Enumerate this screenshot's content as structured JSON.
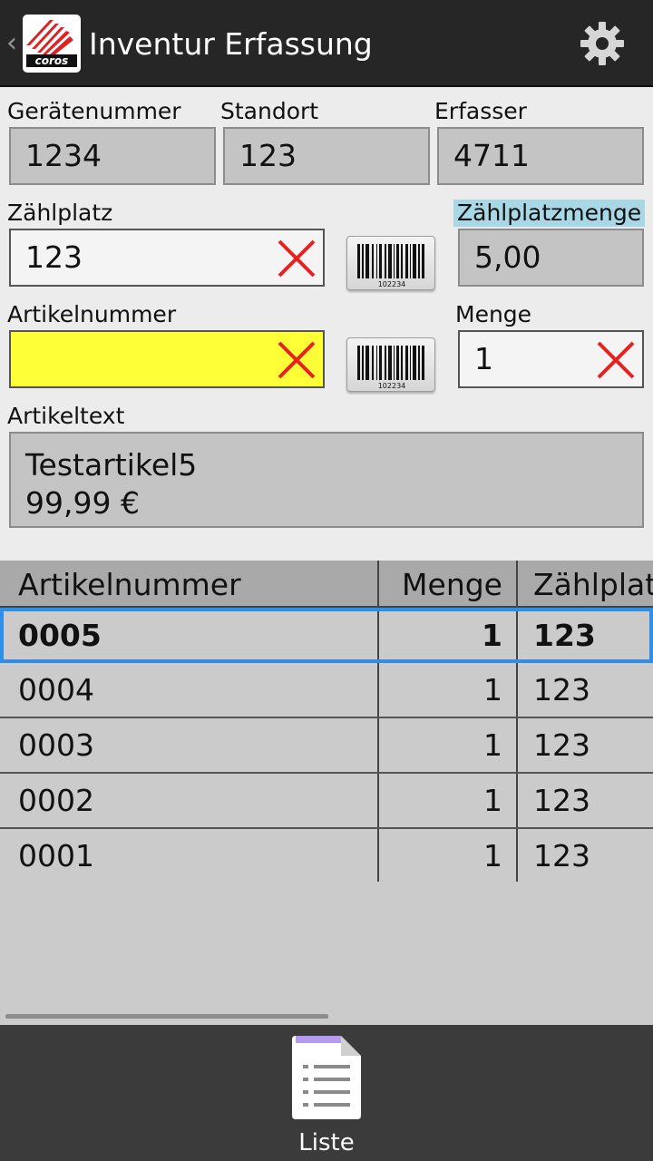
{
  "appbar": {
    "title": "Inventur Erfassung",
    "logo_text": "coros"
  },
  "form": {
    "geraetenummer": {
      "label": "Gerätenummer",
      "value": "1234"
    },
    "standort": {
      "label": "Standort",
      "value": "123"
    },
    "erfasser": {
      "label": "Erfasser",
      "value": "4711"
    },
    "zaehlplatz": {
      "label": "Zählplatz",
      "value": "123"
    },
    "zaehlplatzmenge": {
      "label": "Zählplatzmenge",
      "value": "5,00"
    },
    "artikelnummer": {
      "label": "Artikelnummer",
      "value": ""
    },
    "menge": {
      "label": "Menge",
      "value": "1"
    },
    "artikeltext": {
      "label": "Artikeltext",
      "line1": "Testartikel5",
      "line2": "99,99 €"
    },
    "barcode_number": "102234"
  },
  "table": {
    "headers": [
      "Artikelnummer",
      "Menge",
      "Zählplatz"
    ],
    "rows": [
      {
        "artikelnummer": "0005",
        "menge": "1",
        "zaehlplatz": "123"
      },
      {
        "artikelnummer": "0004",
        "menge": "1",
        "zaehlplatz": "123"
      },
      {
        "artikelnummer": "0003",
        "menge": "1",
        "zaehlplatz": "123"
      },
      {
        "artikelnummer": "0002",
        "menge": "1",
        "zaehlplatz": "123"
      },
      {
        "artikelnummer": "0001",
        "menge": "1",
        "zaehlplatz": "123"
      }
    ]
  },
  "bottombar": {
    "liste_label": "Liste"
  },
  "colors": {
    "appbar": "#262626",
    "highlight_field": "#ffff38",
    "label_highlight": "#a8d8e6",
    "selection": "#2f8fe8",
    "clear_icon": "#e82020"
  },
  "icons": [
    "back-chevron-icon",
    "logo-icon",
    "gear-icon",
    "clear-x-icon",
    "barcode-icon",
    "list-document-icon"
  ]
}
